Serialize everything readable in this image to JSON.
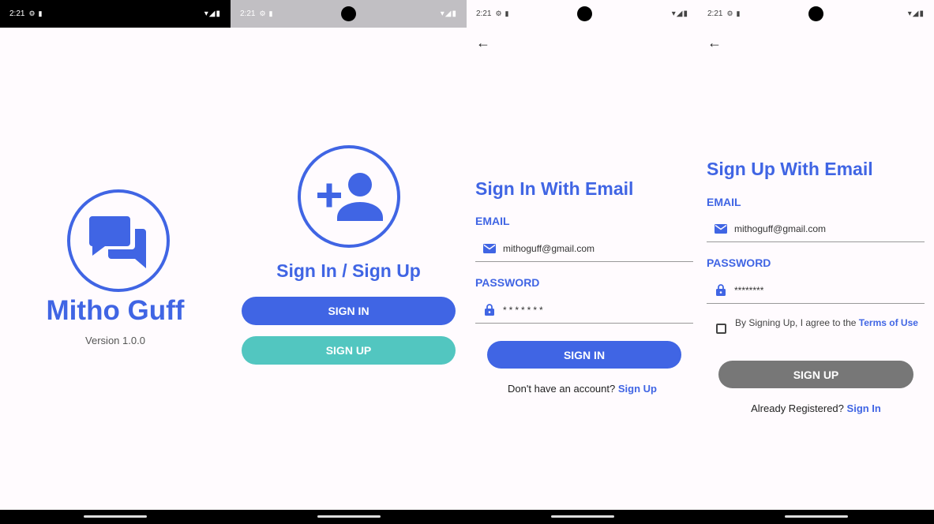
{
  "status": {
    "time": "2:21"
  },
  "splash": {
    "app_name": "Mitho Guff",
    "version": "Version 1.0.0"
  },
  "welcome": {
    "title": "Sign In / Sign Up",
    "sign_in_label": "SIGN IN",
    "sign_up_label": "SIGN UP"
  },
  "sign_in": {
    "title": "Sign In With Email",
    "email_label": "EMAIL",
    "email_value": "mithoguff@gmail.com",
    "password_label": "PASSWORD",
    "password_value": "*******",
    "button_label": "SIGN IN",
    "footer_text": "Don't have an account?",
    "footer_link": "Sign Up"
  },
  "sign_up": {
    "title": "Sign Up With Email",
    "email_label": "EMAIL",
    "email_value": "mithoguff@gmail.com",
    "password_label": "PASSWORD",
    "password_value": "********",
    "terms_text": "By Signing Up, I agree to the",
    "terms_link": "Terms of Use",
    "button_label": "SIGN UP",
    "footer_text": "Already Registered?",
    "footer_link": "Sign In"
  },
  "colors": {
    "primary": "#4065e4",
    "teal": "#52c6c0",
    "disabled": "#777777"
  }
}
